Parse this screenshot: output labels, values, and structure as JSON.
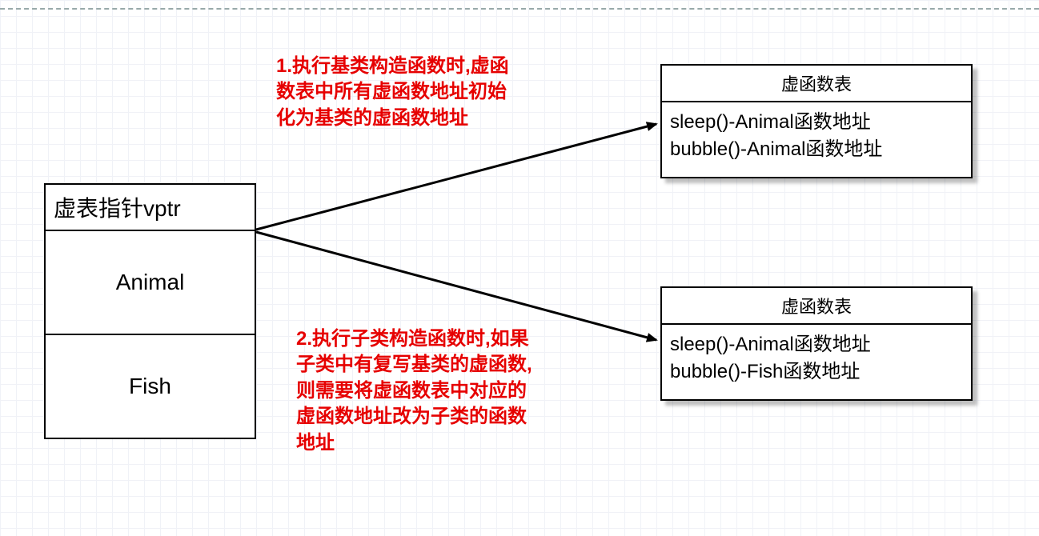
{
  "left_box": {
    "header": "虚表指针vptr",
    "row1": "Animal",
    "row2": "Fish"
  },
  "annotation1": "1.执行基类构造函数时,虚函\n数表中所有虚函数地址初始\n化为基类的虚函数地址",
  "annotation2": "2.执行子类构造函数时,如果\n子类中有复写基类的虚函数,\n则需要将虚函数表中对应的\n虚函数地址改为子类的函数\n地址",
  "vtable1": {
    "title": "虚函数表",
    "line1": "sleep()-Animal函数地址",
    "line2": "bubble()-Animal函数地址"
  },
  "vtable2": {
    "title": "虚函数表",
    "line1": "sleep()-Animal函数地址",
    "line2": "bubble()-Fish函数地址"
  },
  "colors": {
    "annotation": "#e60000",
    "border": "#000000"
  }
}
